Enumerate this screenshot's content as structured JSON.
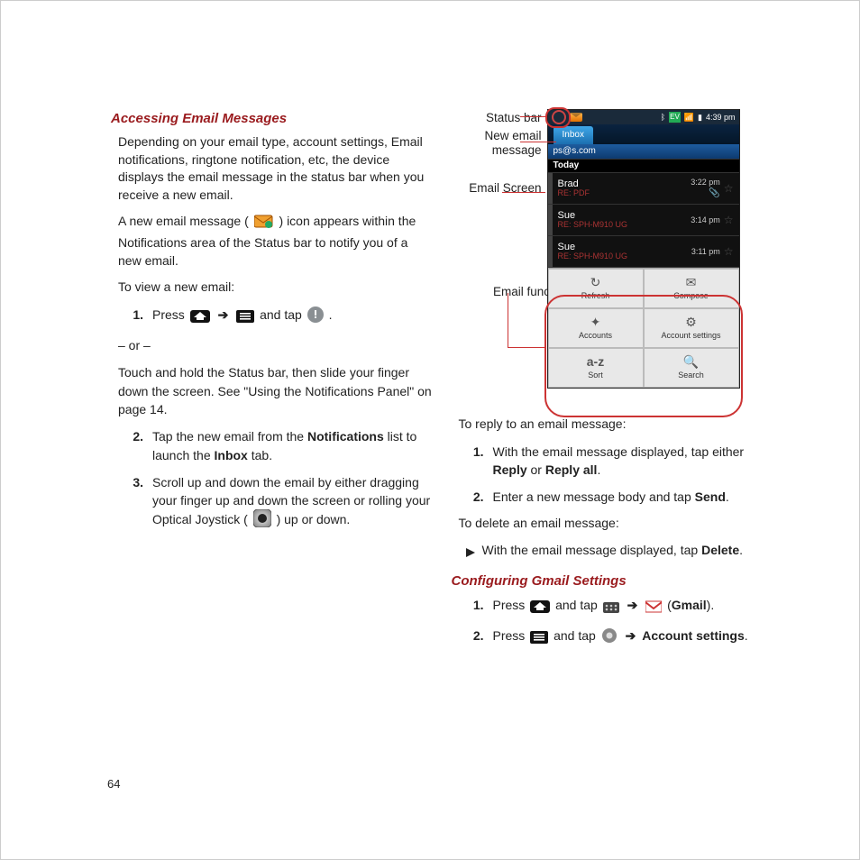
{
  "pageNumber": "64",
  "leftCol": {
    "heading1": "Accessing Email Messages",
    "p1": "Depending on your email type, account settings, Email notifications, ringtone notification, etc, the device displays the email message in the status bar when you receive a new email.",
    "p2a": "A new email message ( ",
    "p2b": " ) icon appears within the Notifications area of the Status bar to notify you of a new email.",
    "p3": "To view a new email:",
    "step1a": "Press ",
    "step1b": " and tap ",
    "step1c": ".",
    "step1or": "– or –",
    "step1alt": "Touch and hold the Status bar, then slide your finger down the screen. See \"Using the Notifications Panel\" on page 14.",
    "step2a": "Tap the new email from the ",
    "step2b": "Notifications",
    "step2c": " list to launch the ",
    "step2d": "Inbox",
    "step2e": " tab.",
    "step3a": "Scroll up and down the email by either dragging your finger up and down the screen or rolling your Optical Joystick ( ",
    "step3b": " ) up or down."
  },
  "rightCol": {
    "callouts": {
      "statusBar": "Status bar",
      "newEmail": "New email message",
      "emailScreen": "Email Screen",
      "emailFunctions": "Email functions"
    },
    "phone": {
      "time": "4:39 pm",
      "tab": "Inbox",
      "account": "ps@s.com",
      "dayHeader": "Today",
      "rows": [
        {
          "from": "Brad",
          "subject": "RE: PDF",
          "time": "3:22 pm"
        },
        {
          "from": "Sue",
          "subject": "RE: SPH-M910 UG",
          "time": "3:14 pm"
        },
        {
          "from": "Sue",
          "subject": "RE: SPH-M910 UG",
          "time": "3:11 pm"
        }
      ],
      "menu": [
        "Refresh",
        "Compose",
        "Accounts",
        "Account settings",
        "Sort",
        "Search"
      ],
      "menuGlyphs": [
        "↻",
        "✉",
        "✦",
        "⚙",
        "a-z",
        "🔍"
      ]
    },
    "replyHeading": "To reply to an email message:",
    "reply1a": "With the email message displayed, tap either ",
    "reply1b": "Reply",
    "reply1c": " or ",
    "reply1d": "Reply all",
    "reply1e": ".",
    "reply2a": "Enter a new message body and tap ",
    "reply2b": "Send",
    "reply2c": ".",
    "deleteHeading": "To delete an email message:",
    "delete1a": "With the email message displayed, tap ",
    "delete1b": "Delete",
    "delete1c": ".",
    "heading2": "Configuring Gmail Settings",
    "g1a": "Press ",
    "g1b": " and tap ",
    "g1c": " (",
    "g1d": "Gmail",
    "g1e": ").",
    "g2a": "Press ",
    "g2b": " and tap ",
    "g2c": "Account settings",
    "g2d": "."
  },
  "numbers": {
    "n1": "1.",
    "n2": "2.",
    "n3": "3."
  }
}
